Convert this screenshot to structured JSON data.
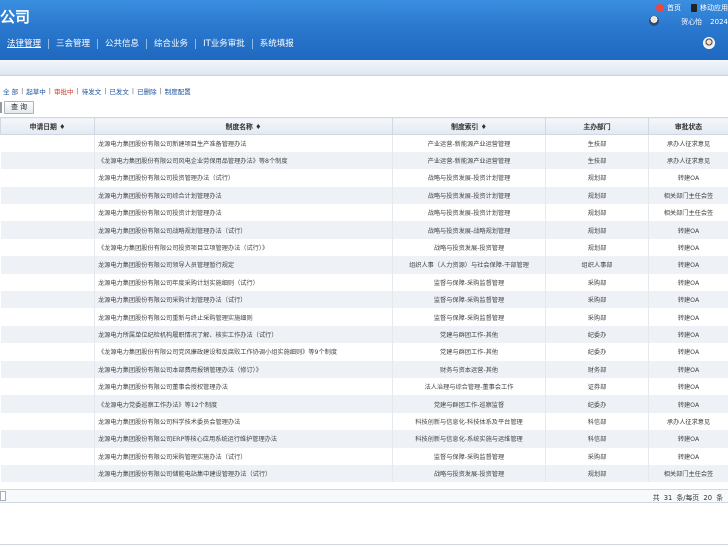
{
  "header": {
    "logo": "公司",
    "top_links": [
      {
        "label": "首页",
        "icon": "home-icon"
      },
      {
        "label": "移动应用",
        "icon": "mobile-icon"
      }
    ],
    "user_name": "贺心怡",
    "year": "2024",
    "nav": [
      {
        "label": "法律管理",
        "active": true
      },
      {
        "label": "三会管理"
      },
      {
        "label": "公共信息"
      },
      {
        "label": "综合业务"
      },
      {
        "label": "IT业务审批"
      },
      {
        "label": "系统填报"
      }
    ]
  },
  "filters": [
    {
      "label": "全 部"
    },
    {
      "label": "起草中"
    },
    {
      "label": "审批中",
      "active": true
    },
    {
      "label": "待发文"
    },
    {
      "label": "已发文"
    },
    {
      "label": "已删除"
    },
    {
      "label": "制度配置"
    }
  ],
  "search_label": "查 询",
  "table": {
    "headers": [
      "申请日期 ♦",
      "制度名称 ♦",
      "制度索引 ♦",
      "主办部门",
      "审批状态"
    ],
    "rows": [
      [
        "",
        "龙源电力集团股份有限公司新建项目生产准备管理办法",
        "产业运营-新能源产业运营管理",
        "生技部",
        "承办人征求意见"
      ],
      [
        "",
        "《龙源电力集团股份有限公司风电企业劳保用品管理办法》等8个制度",
        "产业运营-新能源产业运营管理",
        "生技部",
        "承办人征求意见"
      ],
      [
        "",
        "龙源电力集团股份有限公司投资管理办法（试行）",
        "战略与投资发展-投资计划管理",
        "规划部",
        "转建OA"
      ],
      [
        "",
        "龙源电力集团股份有限公司综合计划管理办法",
        "战略与投资发展-投资计划管理",
        "规划部",
        "相关部门主任会签"
      ],
      [
        "",
        "龙源电力集团股份有限公司投资计划管理办法",
        "战略与投资发展-投资计划管理",
        "规划部",
        "相关部门主任会签"
      ],
      [
        "",
        "龙源电力集团股份有限公司战略规划管理办法（试行）",
        "战略与投资发展-战略规划管理",
        "规划部",
        "转建OA"
      ],
      [
        "",
        "《龙源电力集团股份有限公司投资项目立项管理办法（试行）》",
        "战略与投资发展-投资管理",
        "规划部",
        "转建OA"
      ],
      [
        "",
        "龙源电力集团股份有限公司领导人员管理暂行规定",
        "组织人事（人力资源）与社会保障-干部管理",
        "组织人事部",
        "转建OA"
      ],
      [
        "",
        "龙源电力集团股份有限公司年度采购计划实施细则（试行）",
        "监督与保障-采购监督管理",
        "采购部",
        "转建OA"
      ],
      [
        "",
        "龙源电力集团股份有限公司采购计划管理办法（试行）",
        "监督与保障-采购监督管理",
        "采购部",
        "转建OA"
      ],
      [
        "",
        "龙源电力集团股份有限公司重新与终止采购管理实施细则",
        "监督与保障-采购监督管理",
        "采购部",
        "转建OA"
      ],
      [
        "",
        "龙源电力所属单位纪检机构履职情况了解、核实工作办法（试行）",
        "党建与群团工作-其他",
        "纪委办",
        "转建OA"
      ],
      [
        "",
        "《龙源电力集团股份有限公司党风廉政建设和反腐败工作协调小组实施细则》等9个制度",
        "党建与群团工作-其他",
        "纪委办",
        "转建OA"
      ],
      [
        "",
        "龙源电力集团股份有限公司本部费用报销管理办法（修订）》",
        "财务与资本运营-其他",
        "财务部",
        "转建OA"
      ],
      [
        "",
        "龙源电力集团股份有限公司董事会授权管理办法",
        "法人治理与综合管理-董事会工作",
        "证券部",
        "转建OA"
      ],
      [
        "",
        "《龙源电力党委巡察工作办法》等12个制度",
        "党建与群团工作-巡察监督",
        "纪委办",
        "转建OA"
      ],
      [
        "",
        "龙源电力集团股份有限公司科学技术委员会管理办法",
        "科技创新与信息化-科技体系及平台管理",
        "科信部",
        "承办人征求意见"
      ],
      [
        "",
        "龙源电力集团股份有限公司ERP等核心应用系统运行维护管理办法",
        "科技创新与信息化-系统实施与运维管理",
        "科信部",
        "转建OA"
      ],
      [
        "",
        "龙源电力集团股份有限公司采购管理实施办法（试行）",
        "监督与保障-采购监督管理",
        "采购部",
        "转建OA"
      ],
      [
        "",
        "龙源电力集团股份有限公司储能电站集中建设管理办法（试行）",
        "战略与投资发展-投资管理",
        "规划部",
        "相关部门主任会签"
      ]
    ]
  },
  "pager": {
    "prefix": "共",
    "total": "31",
    "mid": "条/每页",
    "per_page": "20",
    "suffix": "条"
  }
}
